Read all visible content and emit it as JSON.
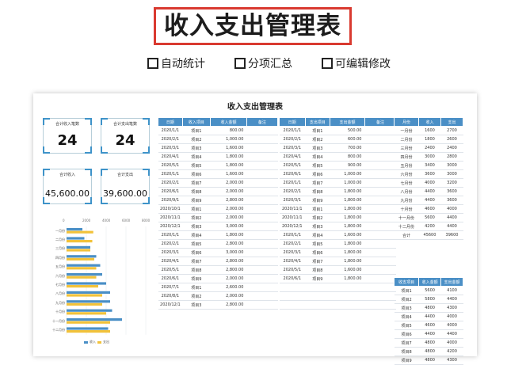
{
  "hero": {
    "title": "收入支出管理表"
  },
  "features": [
    "自动统计",
    "分项汇总",
    "可编辑修改"
  ],
  "sheet": {
    "title": "收入支出管理表"
  },
  "kpis": [
    {
      "label": "合计收入笔数",
      "value": "24"
    },
    {
      "label": "合计支出笔数",
      "value": "24"
    },
    {
      "label": "合计收入",
      "value": "45,600.00"
    },
    {
      "label": "合计支出",
      "value": "39,600.00"
    }
  ],
  "income_table": {
    "headers": [
      "日期",
      "收入项目",
      "收入金额",
      "备注"
    ],
    "rows": [
      [
        "2020/1/1",
        "项目1",
        "800.00",
        ""
      ],
      [
        "2020/2/1",
        "项目2",
        "1,000.00",
        ""
      ],
      [
        "2020/3/1",
        "项目3",
        "1,600.00",
        ""
      ],
      [
        "2020/4/1",
        "项目4",
        "1,800.00",
        ""
      ],
      [
        "2020/5/1",
        "项目5",
        "1,800.00",
        ""
      ],
      [
        "2020/1/1",
        "项目6",
        "1,600.00",
        ""
      ],
      [
        "2020/2/1",
        "项目7",
        "2,000.00",
        ""
      ],
      [
        "2020/6/1",
        "项目8",
        "2,000.00",
        ""
      ],
      [
        "2020/9/1",
        "项目9",
        "2,800.00",
        ""
      ],
      [
        "2020/10/1",
        "项目1",
        "2,000.00",
        ""
      ],
      [
        "2020/11/1",
        "项目2",
        "2,000.00",
        ""
      ],
      [
        "2020/12/1",
        "项目3",
        "3,000.00",
        ""
      ],
      [
        "2020/1/1",
        "项目4",
        "1,800.00",
        ""
      ],
      [
        "2020/2/1",
        "项目5",
        "2,800.00",
        ""
      ],
      [
        "2020/3/1",
        "项目6",
        "3,000.00",
        ""
      ],
      [
        "2020/4/1",
        "项目7",
        "2,800.00",
        ""
      ],
      [
        "2020/5/1",
        "项目8",
        "2,800.00",
        ""
      ],
      [
        "2020/6/1",
        "项目9",
        "2,000.00",
        ""
      ],
      [
        "2020/7/1",
        "项目1",
        "2,600.00",
        ""
      ],
      [
        "2020/8/1",
        "项目2",
        "2,000.00",
        ""
      ],
      [
        "2020/12/1",
        "项目3",
        "2,800.00",
        ""
      ]
    ]
  },
  "expense_table": {
    "headers": [
      "日期",
      "支出项目",
      "支出金额",
      "备注"
    ],
    "rows": [
      [
        "2020/1/1",
        "项目1",
        "500.00",
        ""
      ],
      [
        "2020/2/1",
        "项目2",
        "600.00",
        ""
      ],
      [
        "2020/3/1",
        "项目3",
        "700.00",
        ""
      ],
      [
        "2020/4/1",
        "项目4",
        "800.00",
        ""
      ],
      [
        "2020/5/1",
        "项目5",
        "900.00",
        ""
      ],
      [
        "2020/6/1",
        "项目6",
        "1,000.00",
        ""
      ],
      [
        "2020/1/1",
        "项目7",
        "1,000.00",
        ""
      ],
      [
        "2020/2/1",
        "项目8",
        "1,800.00",
        ""
      ],
      [
        "2020/3/1",
        "项目9",
        "1,800.00",
        ""
      ],
      [
        "2020/11/1",
        "项目1",
        "1,800.00",
        ""
      ],
      [
        "2020/11/1",
        "项目2",
        "1,800.00",
        ""
      ],
      [
        "2020/12/1",
        "项目3",
        "1,800.00",
        ""
      ],
      [
        "2020/1/1",
        "项目4",
        "1,600.00",
        ""
      ],
      [
        "2020/2/1",
        "项目5",
        "1,800.00",
        ""
      ],
      [
        "2020/3/1",
        "项目6",
        "1,800.00",
        ""
      ],
      [
        "2020/4/1",
        "项目7",
        "1,800.00",
        ""
      ],
      [
        "2020/5/1",
        "项目8",
        "1,600.00",
        ""
      ],
      [
        "2020/6/1",
        "项目9",
        "1,800.00",
        ""
      ],
      [
        "",
        "",
        "",
        ""
      ],
      [
        "",
        "",
        "",
        ""
      ],
      [
        "",
        "",
        "",
        ""
      ]
    ]
  },
  "monthly_table": {
    "headers": [
      "月份",
      "收入",
      "支出"
    ],
    "rows": [
      [
        "一月份",
        "1600",
        "2700"
      ],
      [
        "二月份",
        "1800",
        "2600"
      ],
      [
        "三月份",
        "2400",
        "2400"
      ],
      [
        "四月份",
        "3000",
        "2800"
      ],
      [
        "五月份",
        "3400",
        "3000"
      ],
      [
        "六月份",
        "3600",
        "3000"
      ],
      [
        "七月份",
        "4000",
        "3200"
      ],
      [
        "八月份",
        "4400",
        "3600"
      ],
      [
        "九月份",
        "4400",
        "3600"
      ],
      [
        "十月份",
        "4600",
        "4000"
      ],
      [
        "十一月份",
        "5600",
        "4400"
      ],
      [
        "十二月份",
        "4200",
        "4400"
      ],
      [
        "合计",
        "45600",
        "39600"
      ]
    ]
  },
  "project_table": {
    "headers": [
      "收支项目",
      "收入金额",
      "支出金额"
    ],
    "rows": [
      [
        "项目1",
        "5600",
        "4100"
      ],
      [
        "项目2",
        "5800",
        "4400"
      ],
      [
        "项目3",
        "4800",
        "4300"
      ],
      [
        "项目4",
        "4400",
        "4000"
      ],
      [
        "项目5",
        "4600",
        "4000"
      ],
      [
        "项目6",
        "4400",
        "4400"
      ],
      [
        "项目7",
        "4800",
        "4000"
      ],
      [
        "项目8",
        "4800",
        "4200"
      ],
      [
        "项目9",
        "4800",
        "4300"
      ]
    ]
  },
  "chart_data": {
    "type": "bar",
    "orientation": "horizontal",
    "categories": [
      "一月份",
      "二月份",
      "三月份",
      "四月份",
      "五月份",
      "六月份",
      "七月份",
      "八月份",
      "九月份",
      "十月份",
      "十一月份",
      "十二月份"
    ],
    "series": [
      {
        "name": "收入",
        "color": "#4a8fc6",
        "values": [
          1600,
          1800,
          2400,
          3000,
          3400,
          3600,
          4000,
          4400,
          4400,
          4600,
          5600,
          4200
        ]
      },
      {
        "name": "支出",
        "color": "#f2c23a",
        "values": [
          2700,
          2600,
          2400,
          2800,
          3000,
          3000,
          3200,
          3600,
          3600,
          4000,
          4400,
          4400
        ]
      }
    ],
    "xlim": [
      0,
      8000
    ],
    "xticks": [
      "0",
      "2000",
      "4000",
      "6000",
      "8000"
    ],
    "legend": "bottom"
  }
}
